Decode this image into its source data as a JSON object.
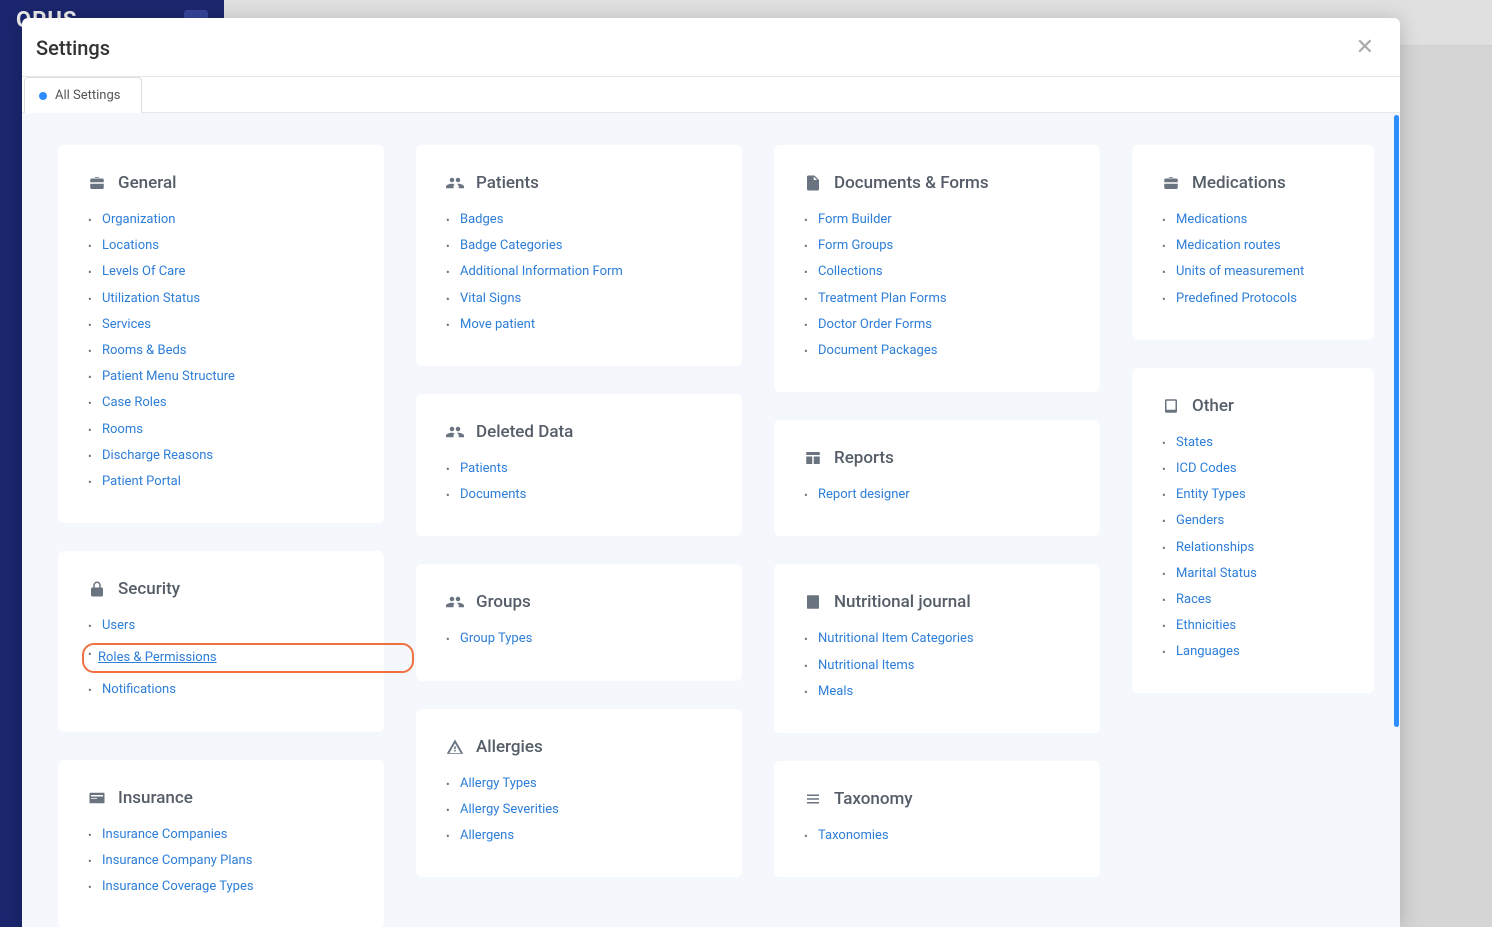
{
  "background": {
    "logo": "OPUS"
  },
  "modal": {
    "title": "Settings",
    "tab": "All Settings"
  },
  "sections": {
    "general": {
      "title": "General",
      "items": [
        "Organization",
        "Locations",
        "Levels Of Care",
        "Utilization Status",
        "Services",
        "Rooms & Beds",
        "Patient Menu Structure",
        "Case Roles",
        "Rooms",
        "Discharge Reasons",
        "Patient Portal"
      ]
    },
    "security": {
      "title": "Security",
      "items": [
        "Users",
        "Roles & Permissions",
        "Notifications"
      ]
    },
    "insurance": {
      "title": "Insurance",
      "items": [
        "Insurance Companies",
        "Insurance Company Plans",
        "Insurance Coverage Types"
      ]
    },
    "patients": {
      "title": "Patients",
      "items": [
        "Badges",
        "Badge Categories",
        "Additional Information Form",
        "Vital Signs",
        "Move patient"
      ]
    },
    "deleted": {
      "title": "Deleted Data",
      "items": [
        "Patients",
        "Documents"
      ]
    },
    "groups": {
      "title": "Groups",
      "items": [
        "Group Types"
      ]
    },
    "allergies": {
      "title": "Allergies",
      "items": [
        "Allergy Types",
        "Allergy Severities",
        "Allergens"
      ]
    },
    "documents": {
      "title": "Documents & Forms",
      "items": [
        "Form Builder",
        "Form Groups",
        "Collections",
        "Treatment Plan Forms",
        "Doctor Order Forms",
        "Document Packages"
      ]
    },
    "reports": {
      "title": "Reports",
      "items": [
        "Report designer"
      ]
    },
    "nutrition": {
      "title": "Nutritional journal",
      "items": [
        "Nutritional Item Categories",
        "Nutritional Items",
        "Meals"
      ]
    },
    "taxonomy": {
      "title": "Taxonomy",
      "items": [
        "Taxonomies"
      ]
    },
    "medications": {
      "title": "Medications",
      "items": [
        "Medications",
        "Medication routes",
        "Units of measurement",
        "Predefined Protocols"
      ]
    },
    "other": {
      "title": "Other",
      "items": [
        "States",
        "ICD Codes",
        "Entity Types",
        "Genders",
        "Relationships",
        "Marital Status",
        "Races",
        "Ethnicities",
        "Languages"
      ]
    }
  },
  "highlighted": "Roles & Permissions"
}
